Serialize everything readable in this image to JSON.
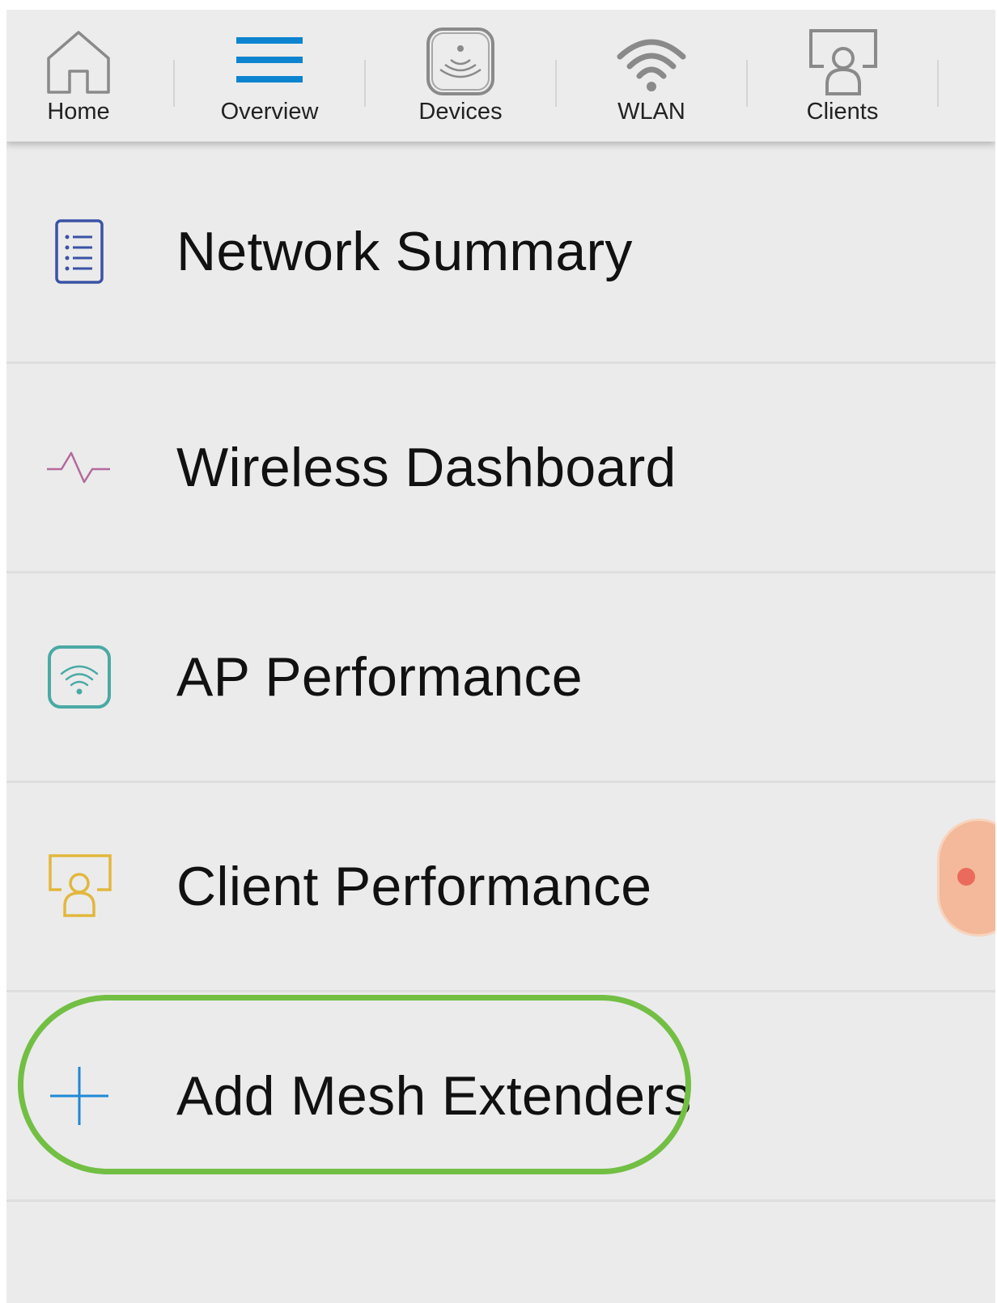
{
  "tabs": [
    {
      "label": "Home",
      "icon": "home-icon",
      "selected": false
    },
    {
      "label": "Overview",
      "icon": "menu-lines-icon",
      "selected": true
    },
    {
      "label": "Devices",
      "icon": "access-point-icon",
      "selected": false
    },
    {
      "label": "WLAN",
      "icon": "wifi-icon",
      "selected": false
    },
    {
      "label": "Clients",
      "icon": "client-person-icon",
      "selected": false
    }
  ],
  "menu": {
    "items": [
      {
        "label": "Network Summary",
        "icon": "list-document-icon",
        "color": "#3a53a4"
      },
      {
        "label": "Wireless Dashboard",
        "icon": "pulse-icon",
        "color": "#b36a9c"
      },
      {
        "label": "AP Performance",
        "icon": "wifi-box-icon",
        "color": "#4aa9a4"
      },
      {
        "label": "Client Performance",
        "icon": "client-person-icon",
        "color": "#e2b73c"
      },
      {
        "label": "Add Mesh Extenders",
        "icon": "plus-icon",
        "color": "#1e88d6",
        "highlighted": true
      }
    ]
  },
  "colors": {
    "accent_blue": "#0d84cf",
    "highlight_green": "#72bf44",
    "background": "#ebebeb"
  },
  "fab": {
    "icon": "chat-bubble-icon",
    "color": "#f3b99a"
  }
}
